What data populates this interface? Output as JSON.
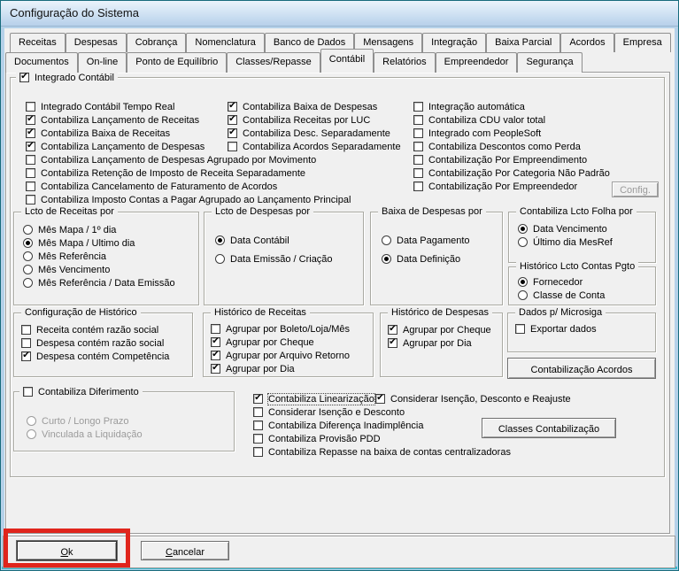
{
  "window": {
    "title": "Configuração do Sistema"
  },
  "colors": {
    "annotation_red": "#e0251c"
  },
  "tabs": {
    "row1": [
      {
        "label": "Receitas"
      },
      {
        "label": "Despesas"
      },
      {
        "label": "Cobrança"
      },
      {
        "label": "Nomenclatura"
      },
      {
        "label": "Banco de Dados"
      },
      {
        "label": "Mensagens"
      },
      {
        "label": "Integração"
      },
      {
        "label": "Baixa Parcial"
      },
      {
        "label": "Acordos"
      },
      {
        "label": "Empresa"
      }
    ],
    "row2": [
      {
        "label": "Documentos"
      },
      {
        "label": "On-line"
      },
      {
        "label": "Ponto de Equilíbrio"
      },
      {
        "label": "Classes/Repasse"
      },
      {
        "label": "Contábil",
        "active": true
      },
      {
        "label": "Relatórios"
      },
      {
        "label": "Empreendedor"
      },
      {
        "label": "Segurança"
      }
    ]
  },
  "main_group": {
    "title_check": [
      {
        "label": "Integrado Contábil",
        "checked": true
      }
    ],
    "col1": [
      {
        "label": "Integrado Contábil Tempo Real",
        "checked": false
      },
      {
        "label": "Contabiliza Lançamento de Receitas",
        "checked": true
      },
      {
        "label": "Contabiliza Baixa de Receitas",
        "checked": true
      },
      {
        "label": "Contabiliza Lançamento de Despesas",
        "checked": true
      },
      {
        "label": "Contabiliza Lançamento de Despesas Agrupado por Movimento",
        "checked": false
      },
      {
        "label": "Contabiliza Retenção de Imposto de Receita Separadamente",
        "checked": false
      },
      {
        "label": "Contabiliza Cancelamento de Faturamento de Acordos",
        "checked": false
      },
      {
        "label": "Contabiliza Imposto Contas a Pagar Agrupado ao Lançamento Principal",
        "checked": false
      }
    ],
    "col2": [
      {
        "label": "Contabiliza Baixa de Despesas",
        "checked": true
      },
      {
        "label": "Contabiliza Receitas por LUC",
        "checked": true
      },
      {
        "label": "Contabiliza Desc. Separadamente",
        "checked": true
      },
      {
        "label": "Contabiliza Acordos Separadamente",
        "checked": false
      }
    ],
    "col3": [
      {
        "label": "Integração automática",
        "checked": false
      },
      {
        "label": "Contabiliza CDU valor total",
        "checked": false
      },
      {
        "label": "Integrado com PeopleSoft",
        "checked": false
      },
      {
        "label": "Contabiliza Descontos como Perda",
        "checked": false
      },
      {
        "label": "Contabilização Por Empreendimento",
        "checked": false
      },
      {
        "label": "Contabilização Por Categoria Não Padrão",
        "checked": false
      },
      {
        "label": "Contabilização Por Empreendedor",
        "checked": false
      }
    ],
    "config_button": "Config."
  },
  "lcto_receitas": {
    "title": "Lcto de Receitas por",
    "options": [
      {
        "label": "Mês Mapa / 1º dia",
        "selected": false
      },
      {
        "label": "Mês Mapa / Ultimo dia",
        "selected": true
      },
      {
        "label": "Mês Referência",
        "selected": false
      },
      {
        "label": "Mês Vencimento",
        "selected": false
      },
      {
        "label": "Mês Referência / Data Emissão",
        "selected": false
      }
    ]
  },
  "lcto_despesas": {
    "title": "Lcto de Despesas por",
    "options": [
      {
        "label": "Data Contábil",
        "selected": true
      },
      {
        "label": "Data Emissão / Criação",
        "selected": false
      }
    ]
  },
  "baixa_despesas": {
    "title": "Baixa de Despesas por",
    "options": [
      {
        "label": "Data Pagamento",
        "selected": false
      },
      {
        "label": "Data Definição",
        "selected": true
      }
    ]
  },
  "folha": {
    "title": "Contabiliza Lcto Folha por",
    "options": [
      {
        "label": "Data Vencimento",
        "selected": true
      },
      {
        "label": "Último dia MesRef",
        "selected": false
      }
    ]
  },
  "hist_pgto": {
    "title": "Histórico Lcto Contas Pgto",
    "options": [
      {
        "label": "Fornecedor",
        "selected": true
      },
      {
        "label": "Classe de Conta",
        "selected": false
      }
    ]
  },
  "config_historico": {
    "title": "Configuração de Histórico",
    "options": [
      {
        "label": "Receita contém razão social",
        "checked": false
      },
      {
        "label": "Despesa contém razão social",
        "checked": false
      },
      {
        "label": "Despesa contém Competência",
        "checked": true
      }
    ]
  },
  "hist_receitas": {
    "title": "Histórico de Receitas",
    "options": [
      {
        "label": "Agrupar por Boleto/Loja/Mês",
        "checked": false
      },
      {
        "label": "Agrupar por Cheque",
        "checked": true
      },
      {
        "label": "Agrupar por Arquivo Retorno",
        "checked": true
      },
      {
        "label": "Agrupar por Dia",
        "checked": true
      }
    ]
  },
  "hist_despesas": {
    "title": "Histórico de Despesas",
    "options": [
      {
        "label": "Agrupar por Cheque",
        "checked": true
      },
      {
        "label": "Agrupar por Dia",
        "checked": true
      }
    ]
  },
  "microsiga": {
    "title": "Dados p/ Microsiga",
    "options": [
      {
        "label": "Exportar dados",
        "checked": false
      }
    ],
    "acordos_button": "Contabilização Acordos"
  },
  "diferimento": {
    "title_check": [
      {
        "label": "Contabiliza Diferimento",
        "checked": false
      }
    ],
    "options": [
      {
        "label": "Curto / Longo Prazo",
        "selected": false,
        "disabled": true
      },
      {
        "label": "Vinculada a Liquidação",
        "selected": false,
        "disabled": true
      }
    ]
  },
  "bottom_checks": [
    {
      "label": "Contabiliza Linearização",
      "checked": true,
      "focused": true
    },
    {
      "label": "Considerar Isenção e Desconto",
      "checked": false
    },
    {
      "label": "Contabiliza Diferença Inadimplência",
      "checked": false
    },
    {
      "label": "Contabiliza Provisão PDD",
      "checked": false
    },
    {
      "label": "Contabiliza Repasse na baixa de contas centralizadoras",
      "checked": false
    }
  ],
  "reajuste_check": [
    {
      "label": "Considerar Isenção, Desconto e Reajuste",
      "checked": true
    }
  ],
  "classes_button": "Classes Contabilização",
  "footer": {
    "ok": "Ok",
    "cancel": "Cancelar"
  }
}
